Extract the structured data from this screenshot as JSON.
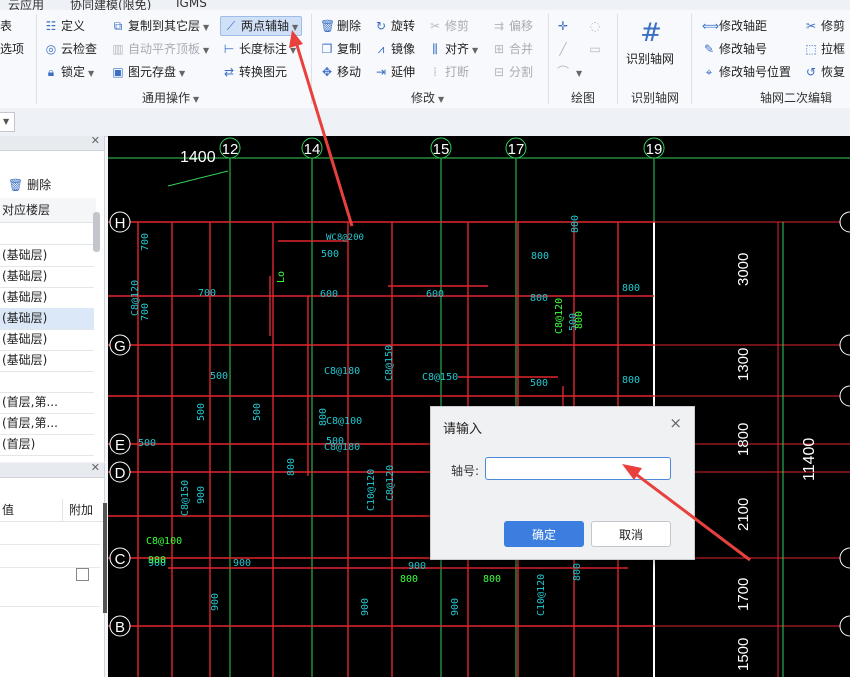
{
  "menubar": {
    "tabs": [
      "云应用",
      "协同建模(限免)",
      "IGMS"
    ]
  },
  "ribbon": {
    "left_cut": [
      "表",
      "选项"
    ],
    "common": {
      "define": "定义",
      "cloud_check": "云检查",
      "lock": "锁定",
      "copy_to_floor": "复制到其它层",
      "auto_flat_top": "自动平齐顶板",
      "element_save": "图元存盘",
      "two_point_axis": "两点辅轴",
      "length_annot": "长度标注",
      "convert_element": "转换图元",
      "group_label": "通用操作"
    },
    "modify": {
      "delete": "删除",
      "copy": "复制",
      "move": "移动",
      "rotate": "旋转",
      "mirror": "镜像",
      "extend": "延伸",
      "trim": "修剪",
      "align": "对齐",
      "break": "打断",
      "offset": "偏移",
      "merge": "合并",
      "split": "分割",
      "group_label": "修改"
    },
    "draw": {
      "group_label": "绘图"
    },
    "recognize": {
      "button": "识别轴网",
      "group_label": "识别轴网"
    },
    "axis_edit": {
      "modify_spacing": "修改轴距",
      "modify_number": "修改轴号",
      "modify_number_pos": "修改轴号位置",
      "trim_axis": "修剪",
      "box_select": "拉框",
      "restore": "恢复",
      "group_label": "轴网二次编辑"
    }
  },
  "left_panel": {
    "delete_label": "删除",
    "column_header": "对应楼层",
    "rows": [
      "(基础层)",
      "(基础层)",
      "(基础层)",
      "(基础层)",
      "(基础层)",
      "(基础层)",
      "",
      "(首层,第...",
      "(首层,第...",
      "(首层)"
    ],
    "selected_index": 3,
    "props_header_value": "值",
    "props_header_extra": "附加"
  },
  "canvas": {
    "dim_top": "1400",
    "axis_top": [
      "12",
      "14",
      "15",
      "17",
      "19"
    ],
    "axis_left": [
      "H",
      "G",
      "E",
      "D",
      "C",
      "B"
    ],
    "dims_right": [
      "3000",
      "1300",
      "1800",
      "2100",
      "1700",
      "1500"
    ],
    "dim_total": "11400",
    "labels_cyan": [
      "500",
      "600",
      "600",
      "800",
      "800",
      "800",
      "800",
      "700",
      "700",
      "700",
      "500",
      "500",
      "500",
      "500",
      "500",
      "500",
      "800",
      "800",
      "800",
      "900",
      "900",
      "900",
      "900",
      "900",
      "900",
      "900",
      "500",
      "800",
      "C8@180",
      "C8@100",
      "C8@180",
      "C8@150",
      "C8@150",
      "C10@120",
      "C8@120",
      "C8@150",
      "C10@120",
      "C8@120"
    ],
    "labels_green": [
      "C8@120",
      "800",
      "800",
      "800",
      "C8@100",
      "900",
      "Lo"
    ],
    "label_top": "WC8@200"
  },
  "dialog": {
    "title": "请输入",
    "close": "×",
    "field_label": "轴号:",
    "field_value": "",
    "ok": "确定",
    "cancel": "取消"
  },
  "colors": {
    "accent": "#3b7ee0",
    "annotation_arrow": "#e8413d",
    "axis_line": "#33d05a",
    "beam": "#e0252e",
    "text_cyan": "#22c8d0",
    "text_green": "#3cff3c"
  }
}
